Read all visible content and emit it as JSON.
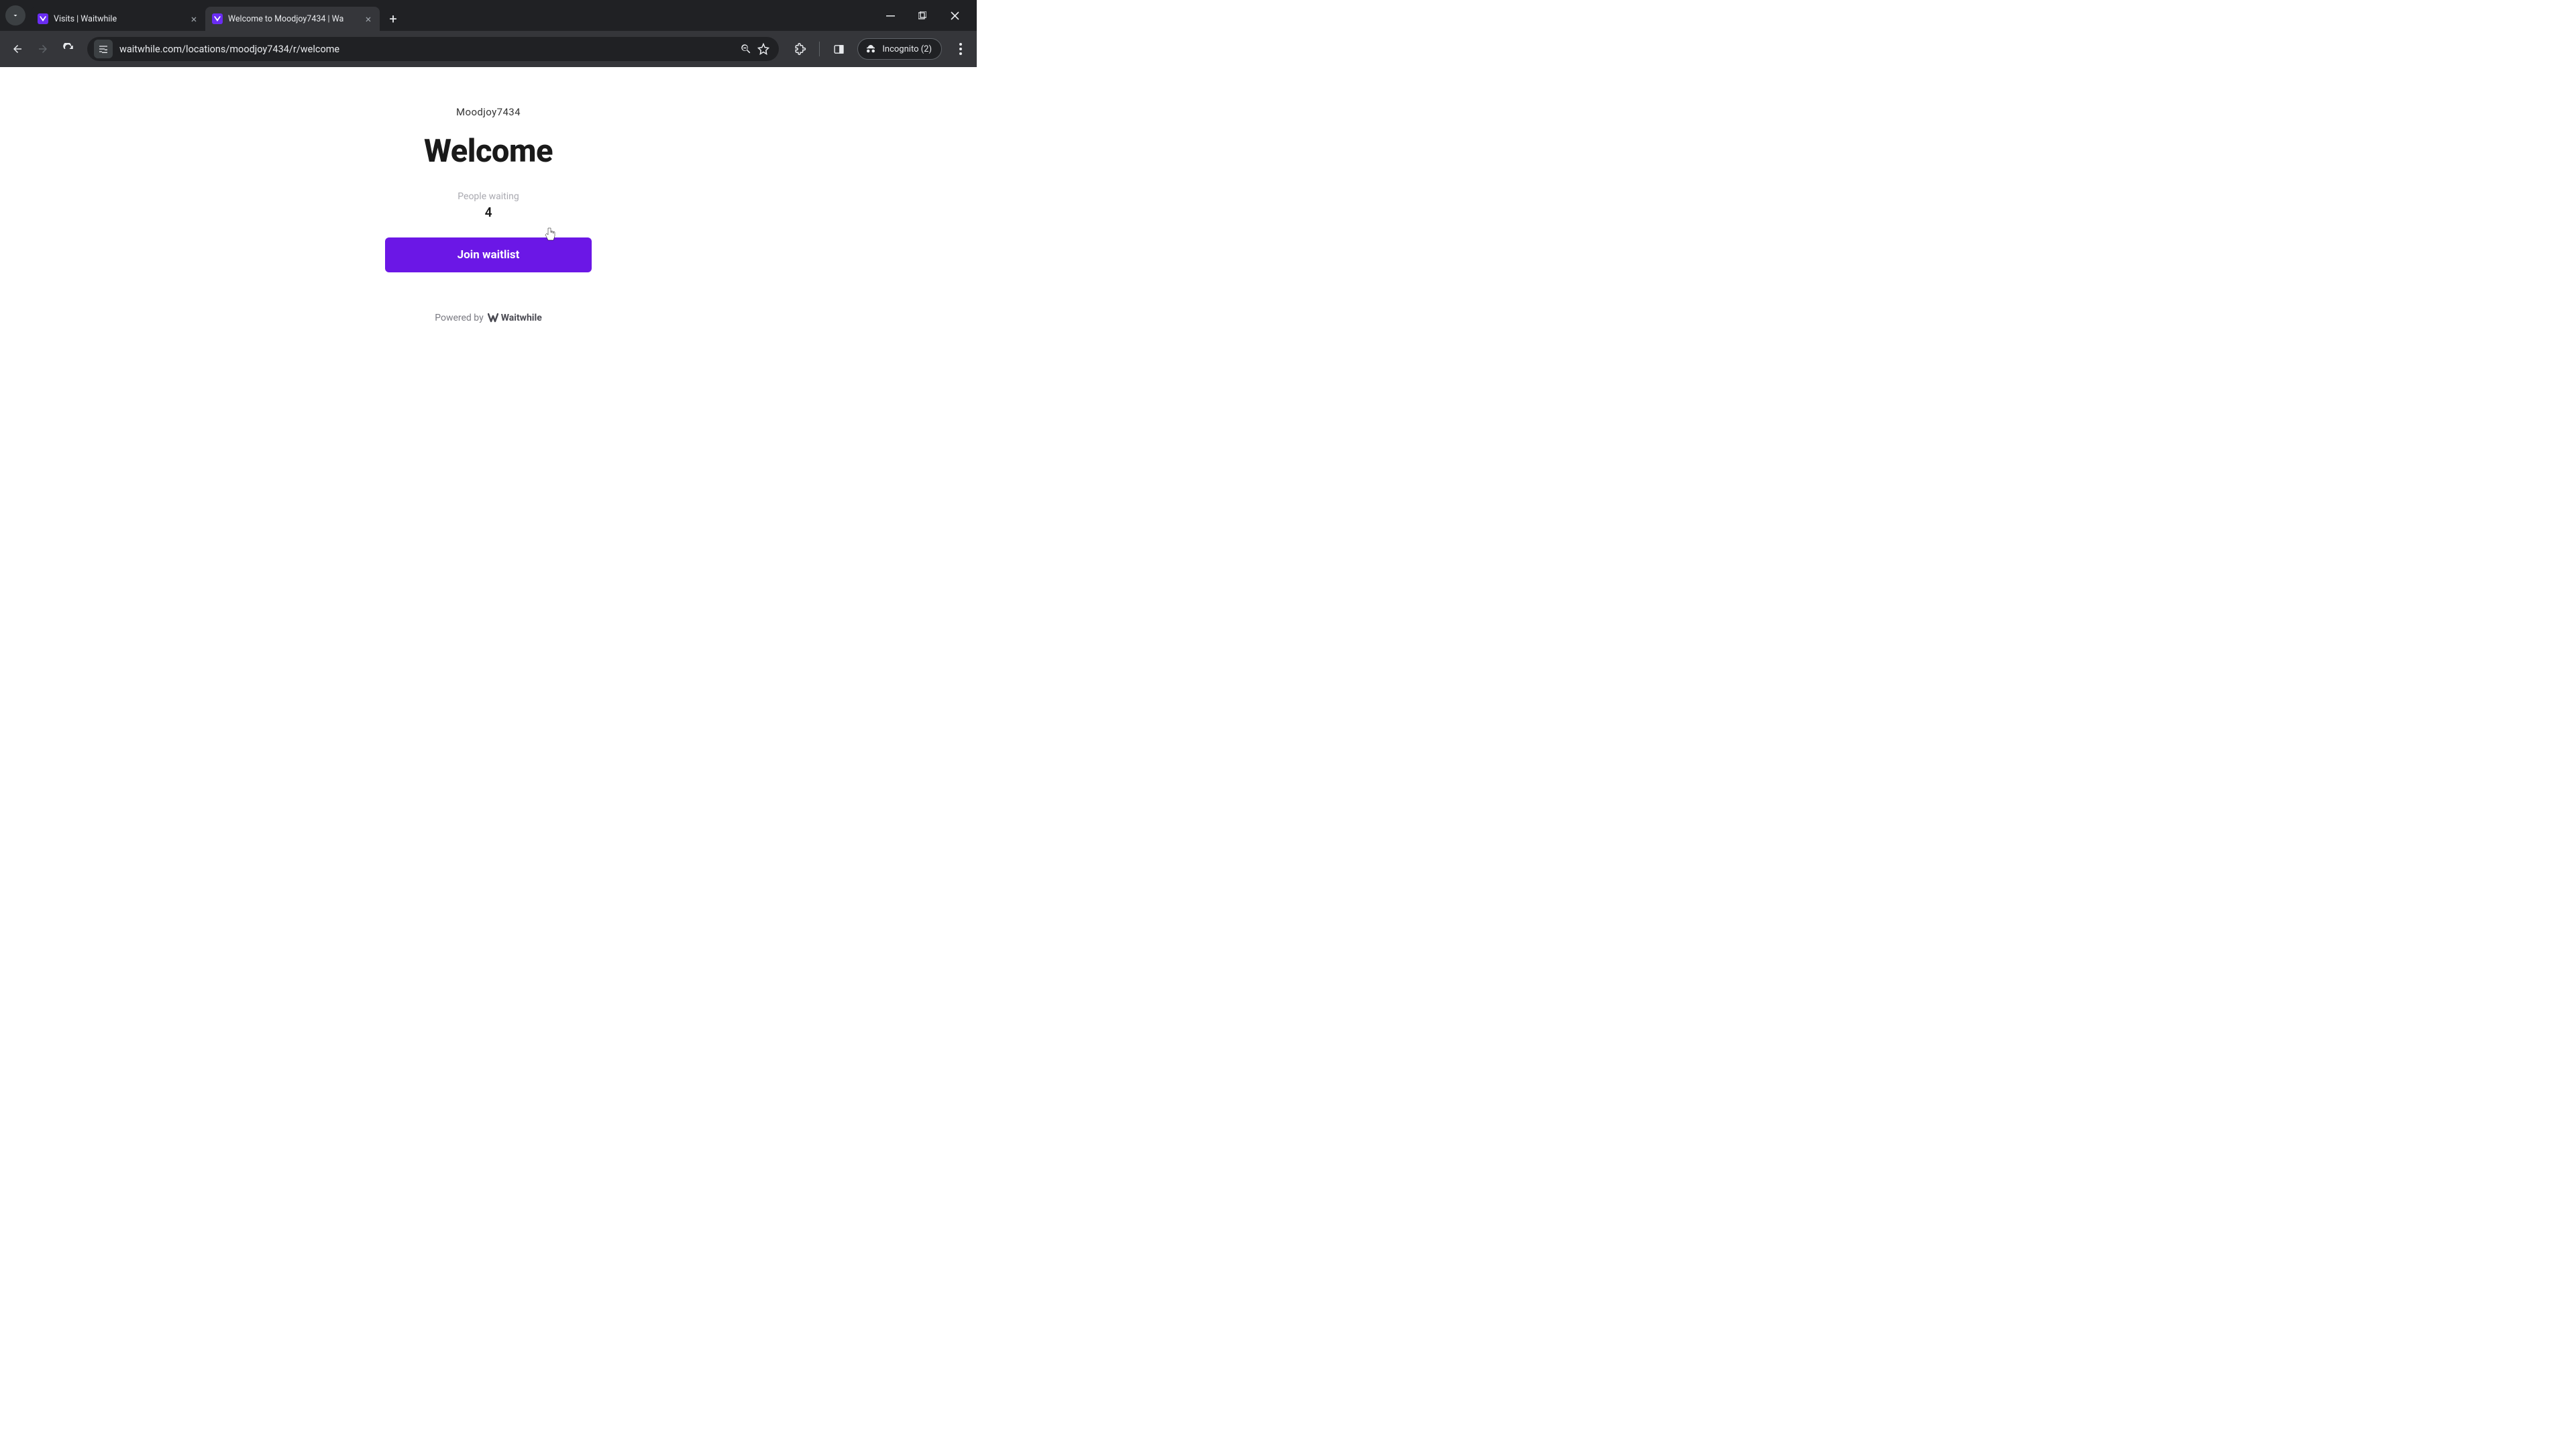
{
  "browser": {
    "tabs": [
      {
        "title": "Visits | Waitwhile",
        "active": false
      },
      {
        "title": "Welcome to Moodjoy7434 | Wa",
        "active": true
      }
    ],
    "url": "waitwhile.com/locations/moodjoy7434/r/welcome",
    "incognito_label": "Incognito (2)"
  },
  "page": {
    "location_name": "Moodjoy7434",
    "heading": "Welcome",
    "waiting_label": "People waiting",
    "waiting_count": "4",
    "join_button_label": "Join waitlist",
    "powered_by_prefix": "Powered by",
    "powered_by_brand": "Waitwhile"
  }
}
